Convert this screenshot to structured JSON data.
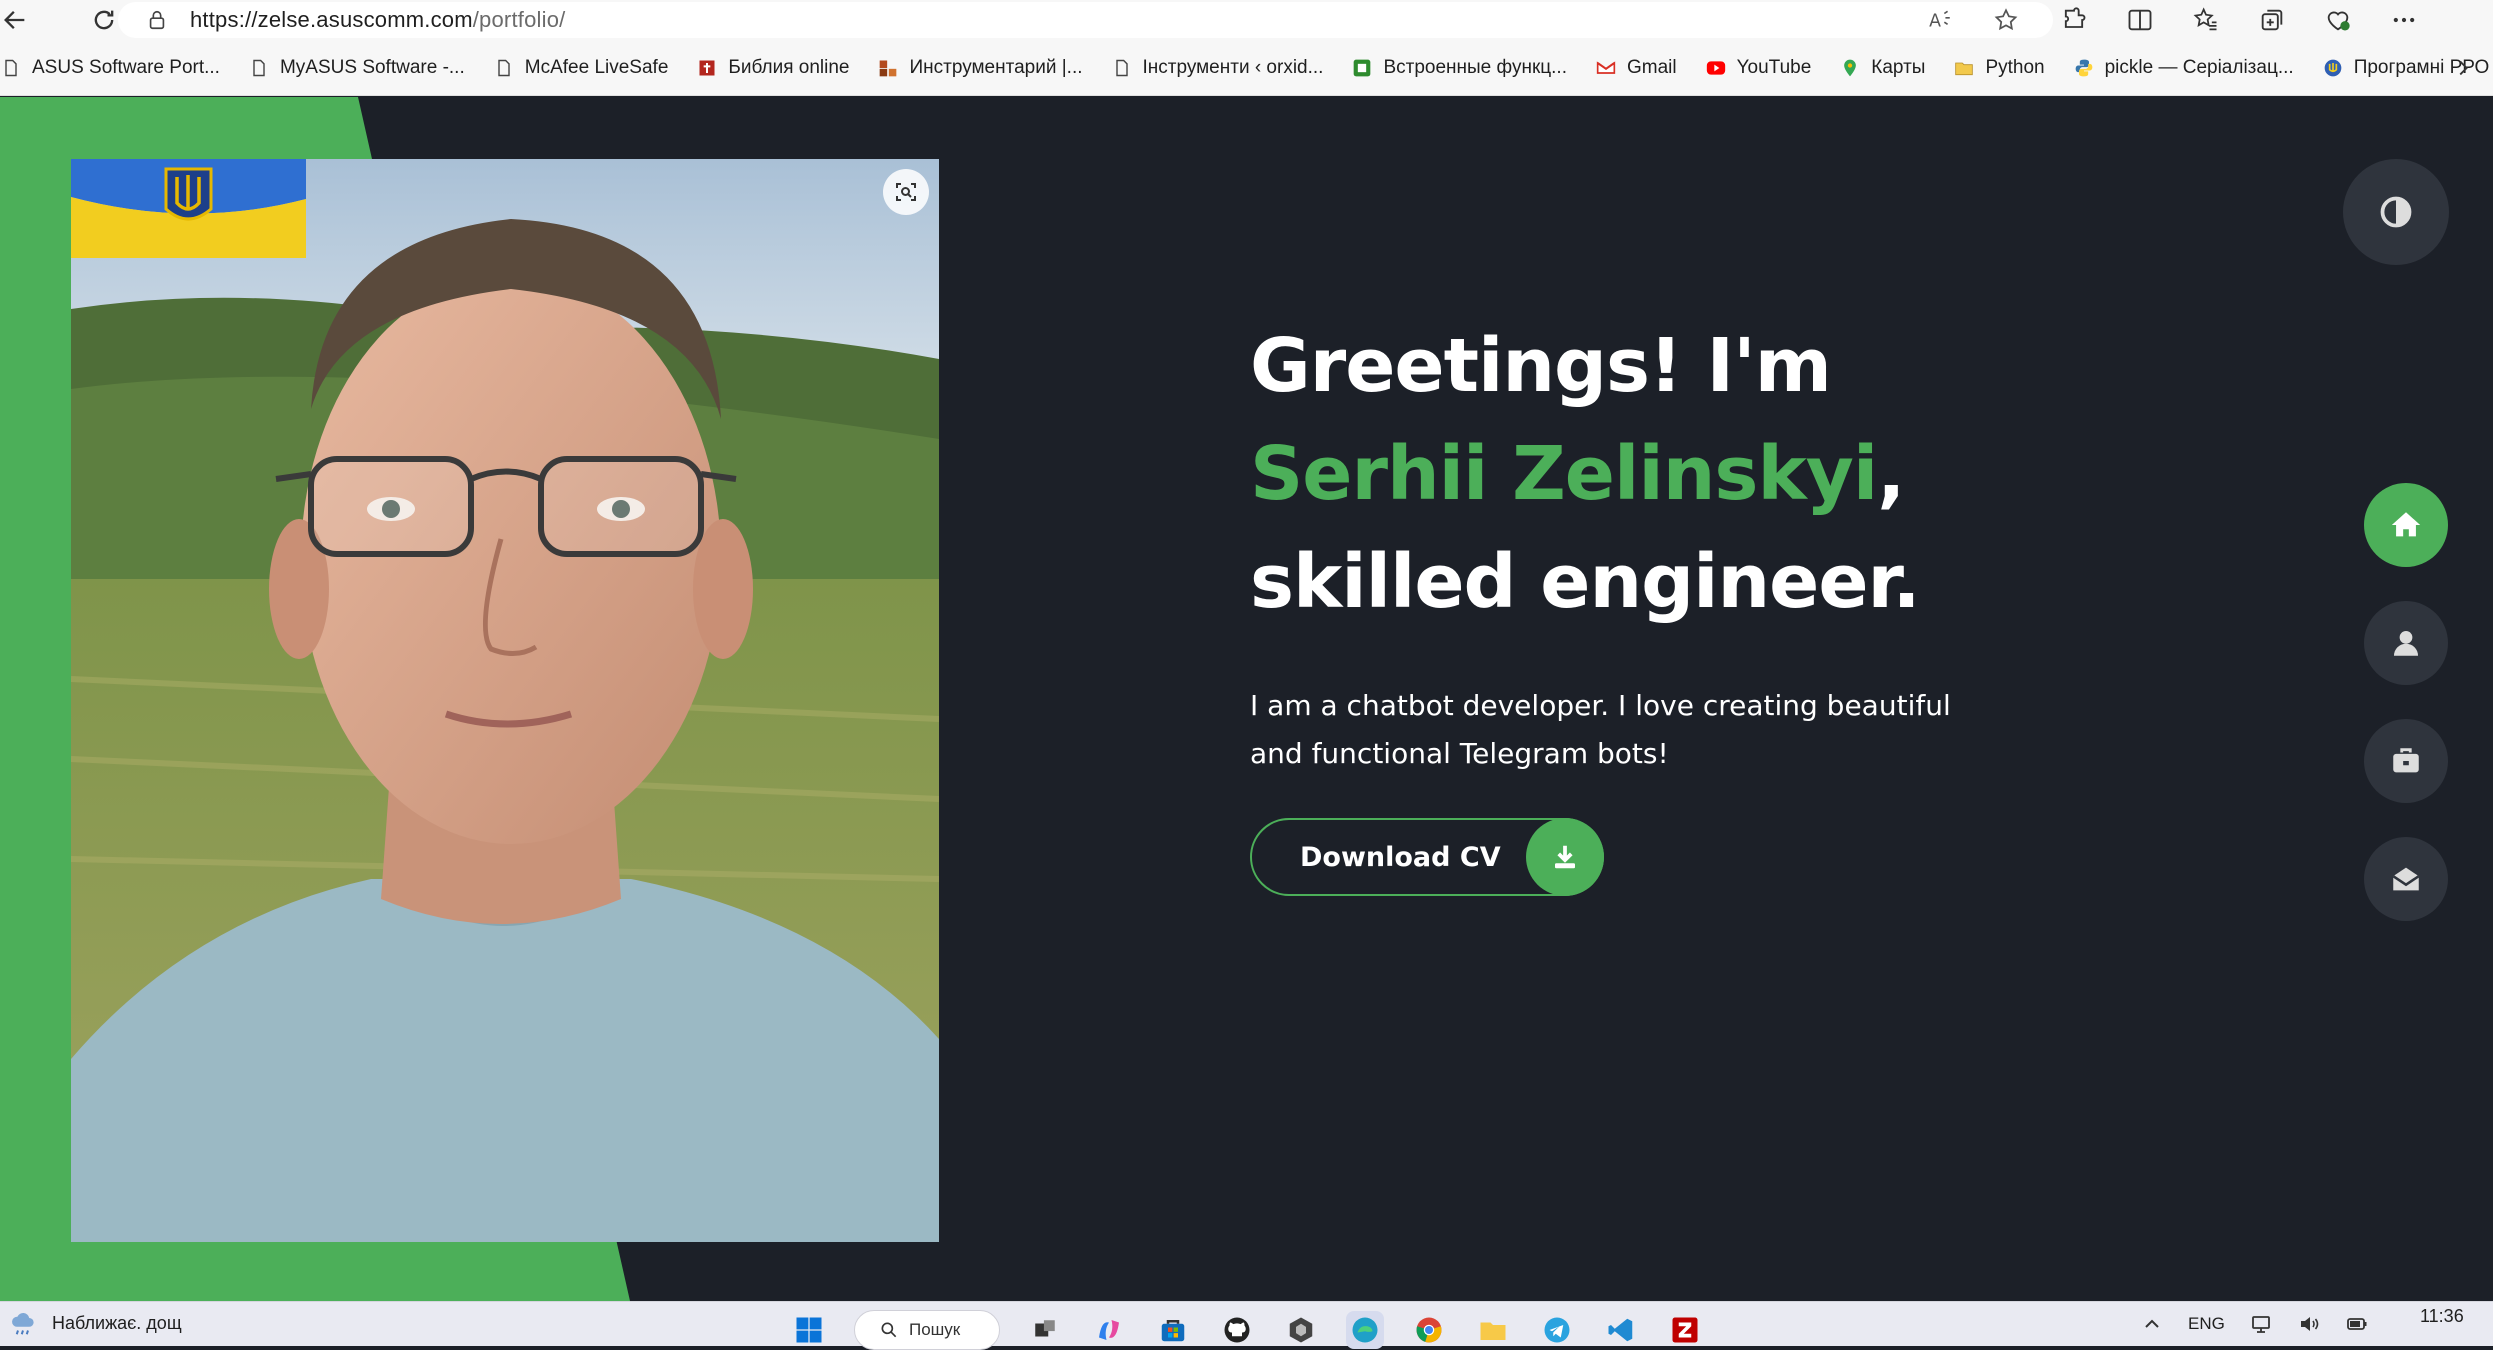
{
  "browser": {
    "url_host": "https://zelse.asuscomm.com",
    "url_path": "/portfolio/",
    "bookmarks": [
      {
        "label": "ASUS Software Port...",
        "icon": "page-icon"
      },
      {
        "label": "MyASUS Software -...",
        "icon": "page-icon"
      },
      {
        "label": "McAfee LiveSafe",
        "icon": "page-icon"
      },
      {
        "label": "Библия online",
        "icon": "bible-icon",
        "color": "#b3261e"
      },
      {
        "label": "Инструментарий |...",
        "icon": "toolkit-icon",
        "color": "#b34a1e"
      },
      {
        "label": "Інструменти ‹ orxid...",
        "icon": "page-icon"
      },
      {
        "label": "Встроенные функц...",
        "icon": "green-square-icon",
        "color": "#2e8b2e"
      },
      {
        "label": "Gmail",
        "icon": "gmail-icon"
      },
      {
        "label": "YouTube",
        "icon": "youtube-icon",
        "color": "#ff0000"
      },
      {
        "label": "Карты",
        "icon": "maps-icon"
      },
      {
        "label": "Python",
        "icon": "folder-icon",
        "color": "#f2c94c"
      },
      {
        "label": "pickle — Серіалізац...",
        "icon": "python-icon"
      },
      {
        "label": "Програмні РРО",
        "icon": "trident-icon"
      }
    ]
  },
  "hero": {
    "greeting": "Greetings! I'm ",
    "name": "Serhii Zelinskyi",
    "tail": ", skilled engineer.",
    "description": "I am a chatbot developer. I love creating beautiful and functional Telegram bots!",
    "cv_label": "Download CV"
  },
  "colors": {
    "accent": "#4caf59",
    "background": "#1c2028",
    "button_dark": "#2f343d"
  },
  "side_nav": [
    {
      "name": "home",
      "icon": "home-icon",
      "active": true
    },
    {
      "name": "about",
      "icon": "user-icon",
      "active": false
    },
    {
      "name": "portfolio",
      "icon": "briefcase-icon",
      "active": false
    },
    {
      "name": "contact",
      "icon": "envelope-open-icon",
      "active": false
    }
  ],
  "taskbar": {
    "weather_text": "Наближає. дощ",
    "search_label": "Пошук",
    "lang": "ENG",
    "time": "11:36"
  }
}
